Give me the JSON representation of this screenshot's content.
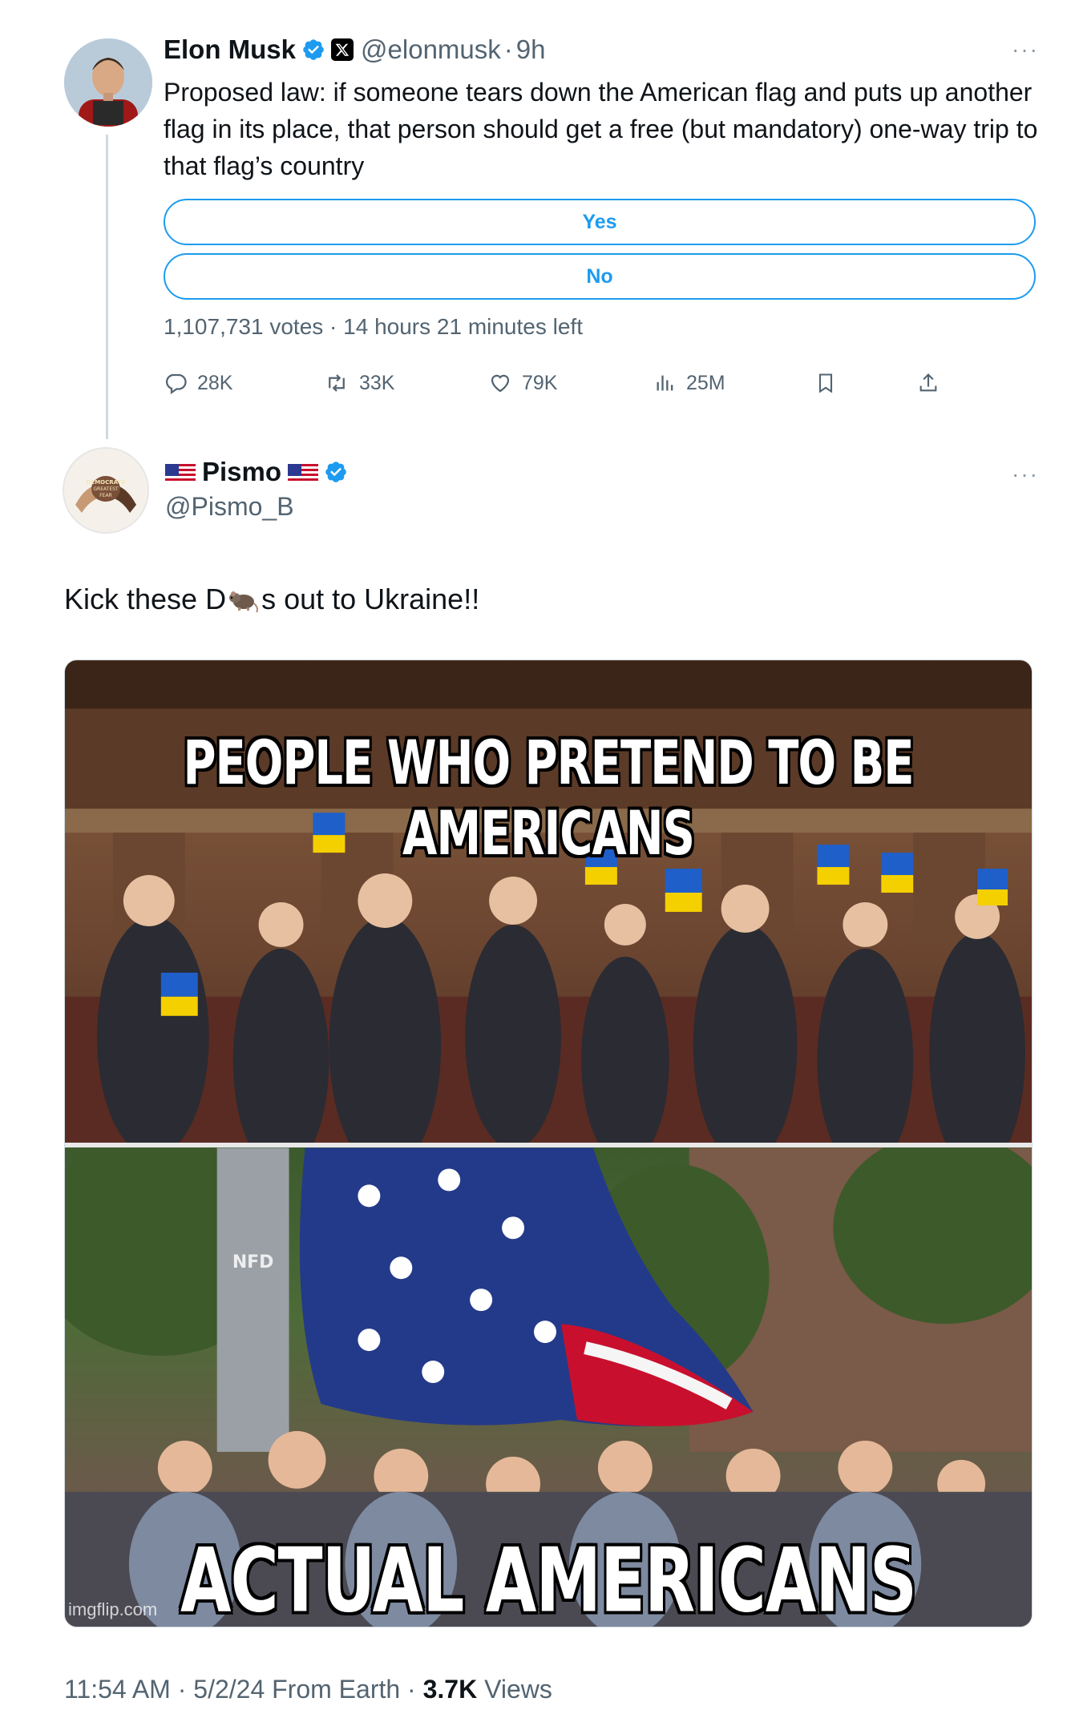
{
  "colors": {
    "accent": "#1d9bf0",
    "secondary_text": "#536471",
    "primary_text": "#0f1419"
  },
  "tweet1": {
    "author_name": "Elon Musk",
    "handle": "@elonmusk",
    "separator": "·",
    "time": "9h",
    "more_icon": "···",
    "text": "Proposed law: if someone tears down the American flag and puts up another flag in its place, that person should get a free (but mandatory) one-way trip to that flag’s country",
    "poll": {
      "options": [
        "Yes",
        "No"
      ],
      "meta": "1,107,731 votes · 14 hours 21 minutes left"
    },
    "actions": {
      "replies": "28K",
      "reposts": "33K",
      "likes": "79K",
      "views": "25M"
    }
  },
  "tweet2": {
    "author_name": "Pismo",
    "handle": "@Pismo_B",
    "more_icon": "···",
    "avatar_text": "DEMOCRATS GREATEST FEAR",
    "text_before": "Kick these D",
    "text_after": "s out to Ukraine!!",
    "image": {
      "caption_top": "PEOPLE WHO PRETEND TO BE AMERICANS",
      "caption_bottom": "ACTUAL AMERICANS",
      "watermark": "imgflip.com",
      "sign_text": "NFD"
    },
    "footer": {
      "time": "11:54 AM",
      "date": "5/2/24",
      "source": "From Earth",
      "views_count": "3.7K",
      "views_label": "Views"
    }
  }
}
